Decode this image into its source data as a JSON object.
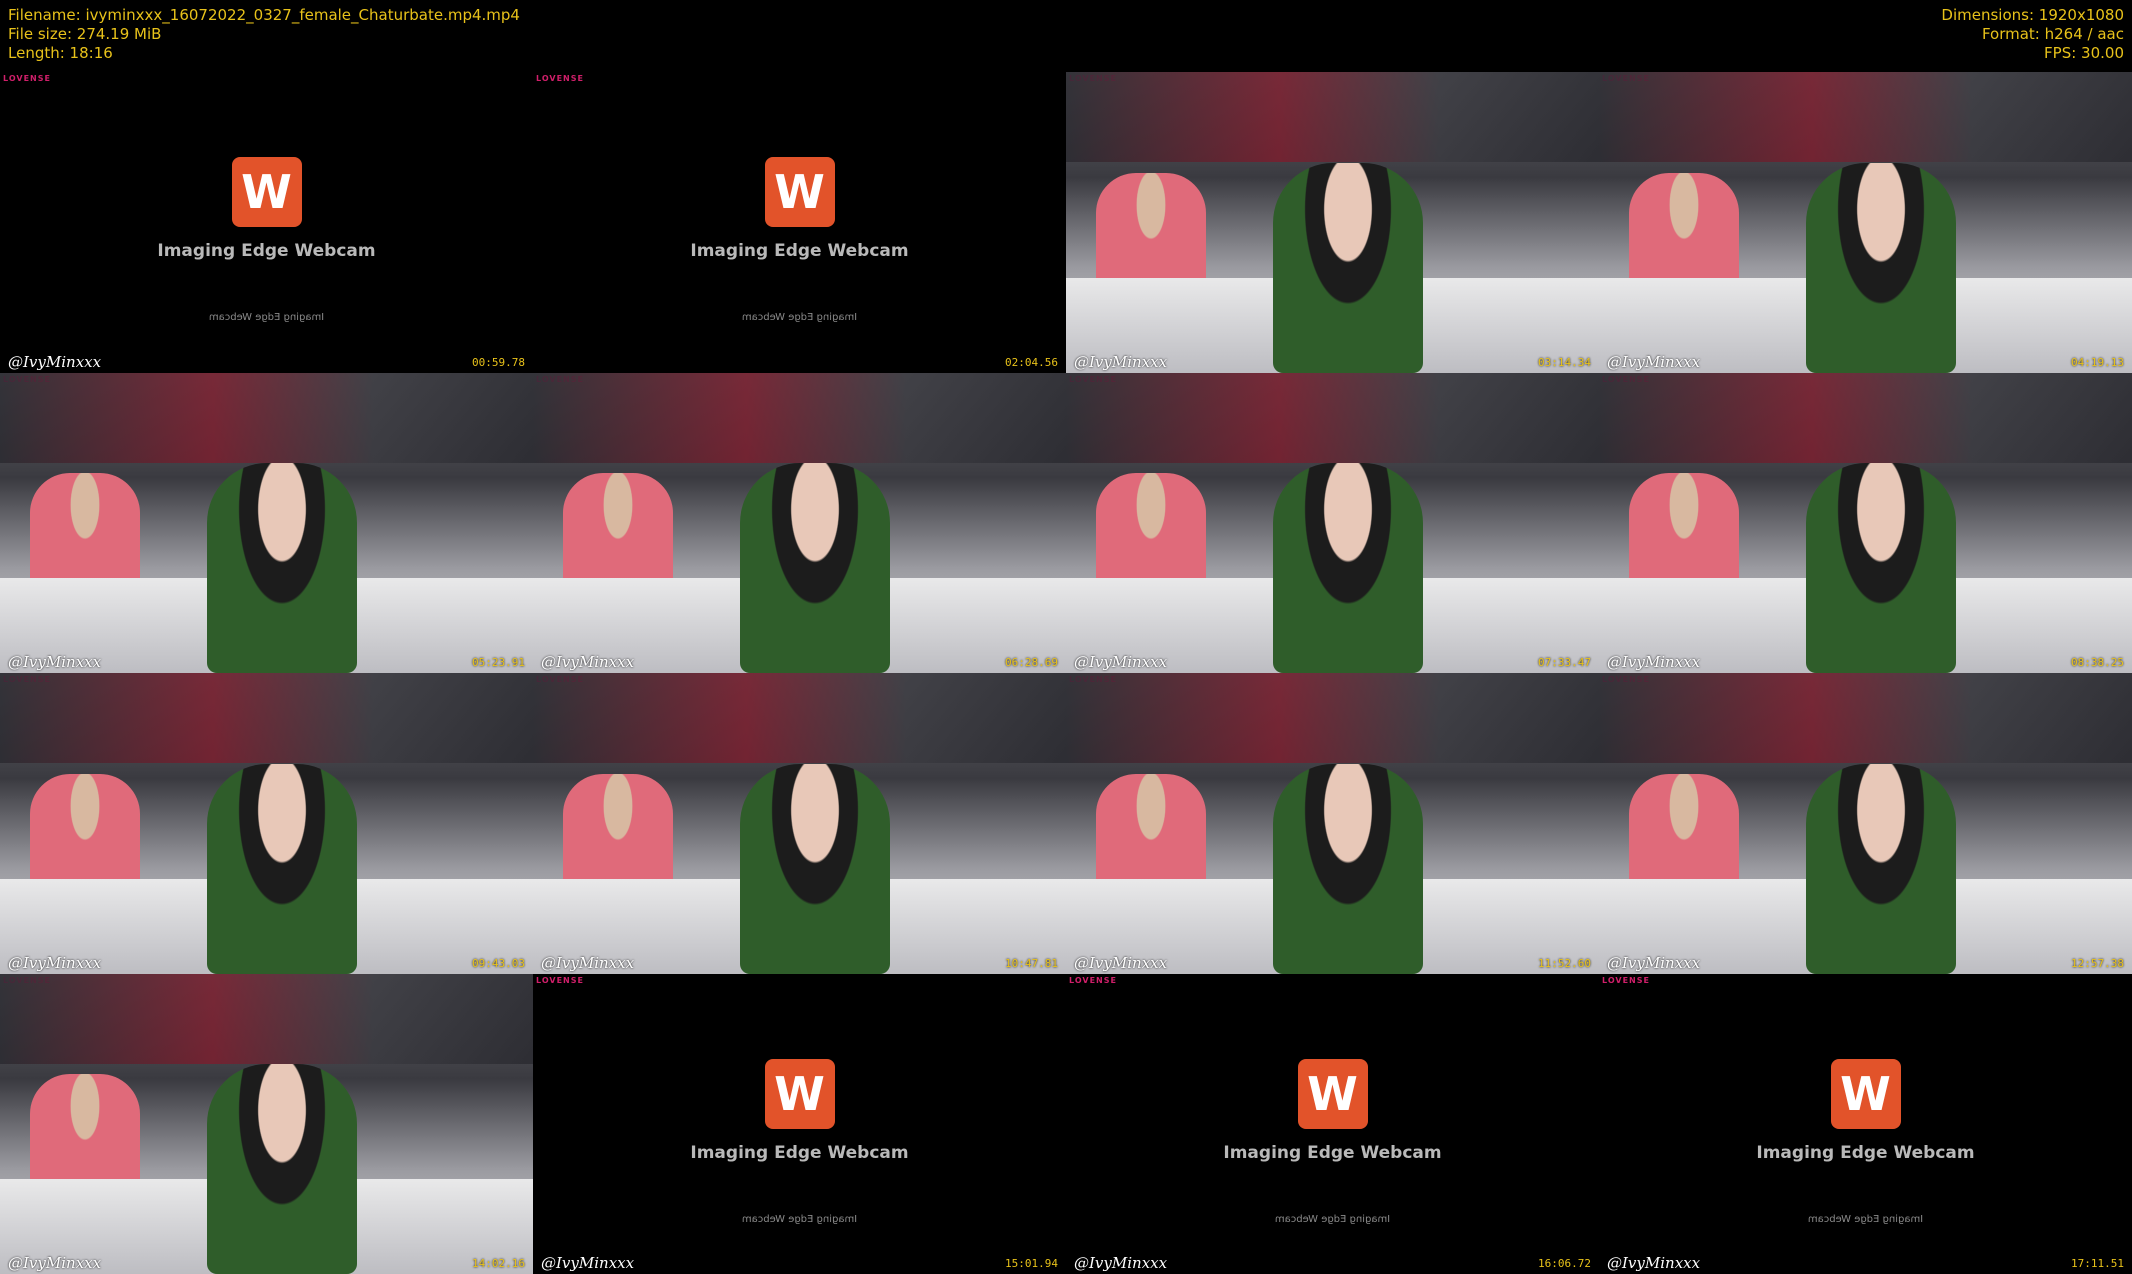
{
  "header_left": {
    "line1": "Filename: ivyminxxx_16072022_0327_female_Chaturbate.mp4.mp4",
    "line2": "File size: 274.19 MiB",
    "line3": "Length: 18:16"
  },
  "header_right": {
    "line1": "Dimensions: 1920x1080",
    "line2": "Format: h264 / aac",
    "line3": "FPS: 30.00"
  },
  "webcam_placeholder": {
    "logo_letter": "W",
    "title": "Imaging Edge Webcam",
    "mirrored_text": "Imaging Edge Webcam"
  },
  "overlay_brand": "LOVENSE",
  "thumbnails": [
    {
      "kind": "placeholder",
      "handle": "@IvyMinxxx",
      "time": "00:59.78"
    },
    {
      "kind": "placeholder",
      "handle": "",
      "time": "02:04.56"
    },
    {
      "kind": "scene",
      "handle": "@IvyMinxxx",
      "time": "03:14.34"
    },
    {
      "kind": "scene",
      "handle": "@IvyMinxxx",
      "time": "04:19.13"
    },
    {
      "kind": "scene",
      "handle": "@IvyMinxxx",
      "time": "05:23.91"
    },
    {
      "kind": "scene",
      "handle": "@IvyMinxxx",
      "time": "06:28.69"
    },
    {
      "kind": "scene",
      "handle": "@IvyMinxxx",
      "time": "07:33.47"
    },
    {
      "kind": "scene",
      "handle": "@IvyMinxxx",
      "time": "08:38.25"
    },
    {
      "kind": "scene",
      "handle": "@IvyMinxxx",
      "time": "09:43.03"
    },
    {
      "kind": "scene",
      "handle": "@IvyMinxxx",
      "time": "10:47.81"
    },
    {
      "kind": "scene",
      "handle": "@IvyMinxxx",
      "time": "11:52.60"
    },
    {
      "kind": "scene",
      "handle": "@IvyMinxxx",
      "time": "12:57.38"
    },
    {
      "kind": "scene",
      "handle": "@IvyMinxxx",
      "time": "14:02.16"
    },
    {
      "kind": "placeholder",
      "handle": "@IvyMinxxx",
      "time": "15:01.94"
    },
    {
      "kind": "placeholder",
      "handle": "@IvyMinxxx",
      "time": "16:06.72"
    },
    {
      "kind": "placeholder",
      "handle": "@IvyMinxxx",
      "time": "17:11.51"
    }
  ]
}
